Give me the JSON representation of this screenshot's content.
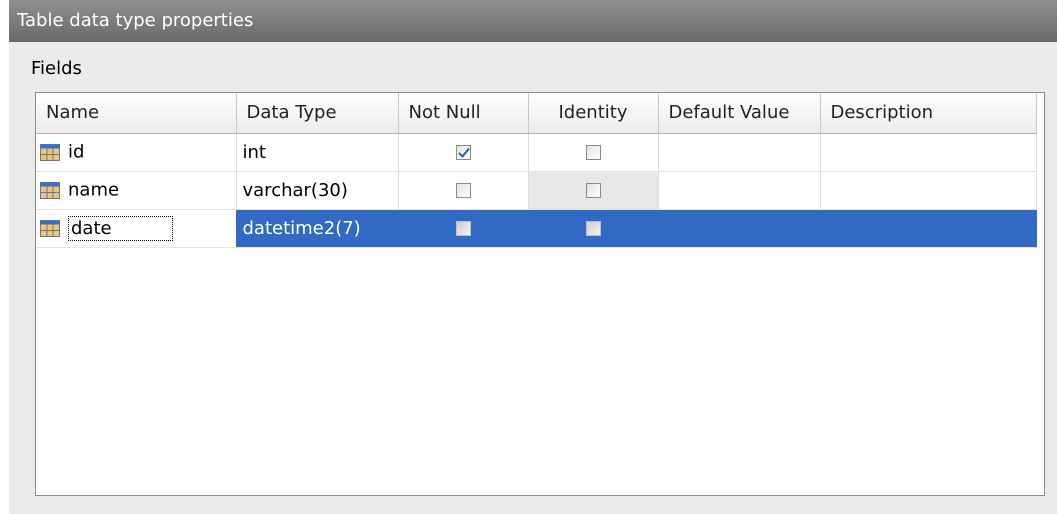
{
  "window": {
    "title": "Table data type properties"
  },
  "section": {
    "label": "Fields"
  },
  "columns": [
    {
      "label": "Name"
    },
    {
      "label": "Data Type"
    },
    {
      "label": "Not Null"
    },
    {
      "label": "Identity"
    },
    {
      "label": "Default Value"
    },
    {
      "label": "Description"
    }
  ],
  "rows": [
    {
      "name": "id",
      "data_type": "int",
      "not_null": true,
      "identity": false,
      "default_value": "",
      "description": ""
    },
    {
      "name": "name",
      "data_type": "varchar(30)",
      "not_null": false,
      "identity": false,
      "default_value": "",
      "description": ""
    },
    {
      "name": "date",
      "data_type": "datetime2(7)",
      "not_null": false,
      "identity": false,
      "default_value": "",
      "description": ""
    }
  ],
  "selected_row": "date",
  "colors": {
    "selection": "#316ac5",
    "titlebar": "#7a7a7a",
    "icon_header": "#3a6fc8",
    "icon_body": "#f2c56b"
  },
  "icons": {
    "row": "table-field-icon"
  }
}
